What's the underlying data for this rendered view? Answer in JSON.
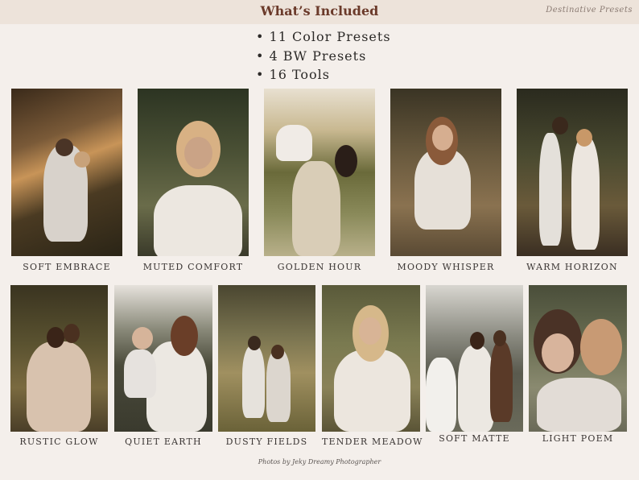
{
  "header": {
    "title": "What’s Included",
    "brand": "Destinative Presets"
  },
  "features": [
    "11 Color Presets",
    "4 BW Presets",
    "16 Tools"
  ],
  "presets_row1": [
    {
      "label": "SOFT EMBRACE",
      "subject": "couple-embracing-photo"
    },
    {
      "label": "MUTED COMFORT",
      "subject": "woman-blonde-hair-photo"
    },
    {
      "label": "GOLDEN HOUR",
      "subject": "mother-lifting-child-photo"
    },
    {
      "label": "MOODY WHISPER",
      "subject": "woman-in-grass-field-photo"
    },
    {
      "label": "WARM HORIZON",
      "subject": "couple-in-forest-photo"
    }
  ],
  "presets_row2": [
    {
      "label": "RUSTIC GLOW",
      "subject": "couple-in-woods-photo"
    },
    {
      "label": "QUIET EARTH",
      "subject": "mother-with-baby-photo"
    },
    {
      "label": "DUSTY FIELDS",
      "subject": "couple-walking-field-photo"
    },
    {
      "label": "TENDER MEADOW",
      "subject": "woman-with-flowers-photo"
    },
    {
      "label": "SOFT MATTE",
      "subject": "wedding-couple-photo"
    },
    {
      "label": "LIGHT POEM",
      "subject": "mother-daughter-lavender-photo"
    }
  ],
  "footer": {
    "credit": "Photos by Jeky Dreamy Photographer"
  }
}
